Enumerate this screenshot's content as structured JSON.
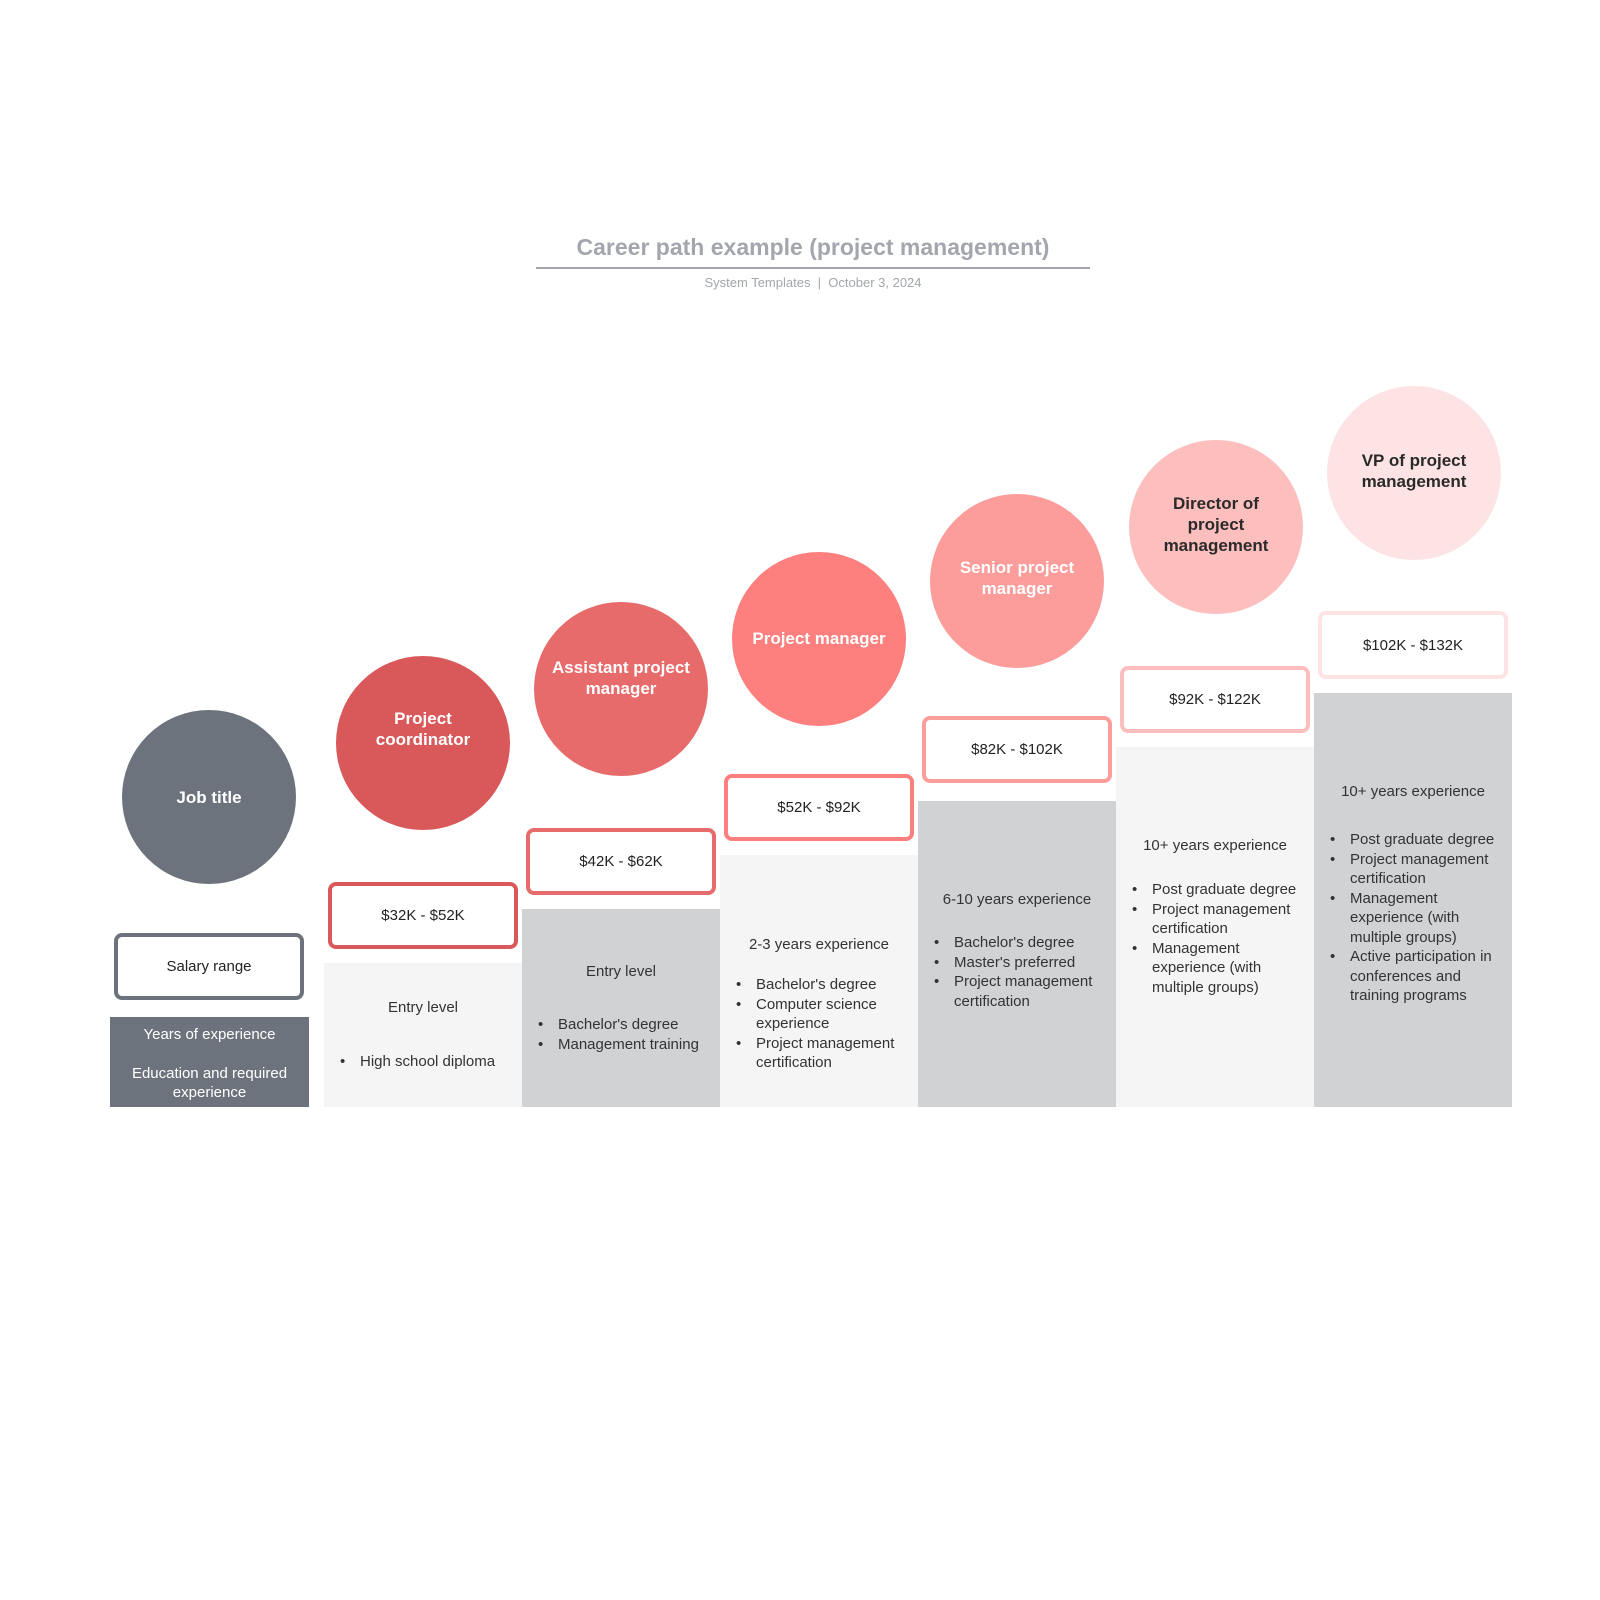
{
  "header": {
    "title": "Career path example (project management)",
    "subtitle": "System Templates  |  October 3, 2024"
  },
  "legend": {
    "job_title": "Job title",
    "salary_range": "Salary range",
    "years_label": "Years of experience",
    "education_label": "Education and required experience",
    "color": "#6d737c"
  },
  "levels": [
    {
      "title": "Project coordinator",
      "salary": "$32K - $52K",
      "experience": "Entry level",
      "education": [
        "High school diploma"
      ],
      "color": "#d9585a"
    },
    {
      "title": "Assistant project manager",
      "salary": "$42K - $62K",
      "experience": "Entry level",
      "education": [
        "Bachelor's degree",
        "Management training"
      ],
      "color": "#e86b6b"
    },
    {
      "title": "Project manager",
      "salary": "$52K - $92K",
      "experience": "2-3 years experience",
      "education": [
        "Bachelor's degree",
        "Computer science experience",
        "Project management certification"
      ],
      "color": "#fd7f7e"
    },
    {
      "title": "Senior project manager",
      "salary": "$82K - $102K",
      "experience": "6-10 years experience",
      "education": [
        "Bachelor's degree",
        "Master's preferred",
        "Project management certification"
      ],
      "color": "#fc9d9c"
    },
    {
      "title": "Director of project management",
      "salary": "$92K - $122K",
      "experience": "10+ years experience",
      "education": [
        "Post graduate degree",
        "Project management certification",
        "Management experience (with multiple groups)"
      ],
      "color": "#fdbebe"
    },
    {
      "title": "VP of project management",
      "salary": "$102K - $132K",
      "experience": "10+ years experience",
      "education": [
        "Post graduate degree",
        "Project management certification",
        "Management experience (with multiple groups)",
        "Active participation in conferences and training programs"
      ],
      "color": "#fde3e3"
    }
  ]
}
